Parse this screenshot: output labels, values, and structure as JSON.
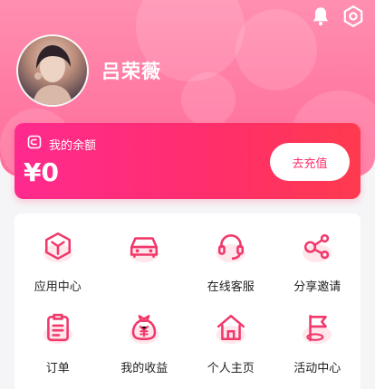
{
  "profile": {
    "name": "吕荣薇"
  },
  "top_icons": [
    "bell-icon",
    "settings-icon"
  ],
  "balance": {
    "title": "我的余额",
    "amount": "¥0",
    "recharge_label": "去充值"
  },
  "menu": {
    "items": [
      {
        "label": "应用中心",
        "icon": "cube-icon"
      },
      {
        "label": "",
        "icon": "car-icon"
      },
      {
        "label": "在线客服",
        "icon": "headset-icon"
      },
      {
        "label": "分享邀请",
        "icon": "share-icon"
      },
      {
        "label": "订单",
        "icon": "clipboard-icon"
      },
      {
        "label": "我的收益",
        "icon": "money-bag-icon"
      },
      {
        "label": "个人主页",
        "icon": "home-icon"
      },
      {
        "label": "活动中心",
        "icon": "flag-icon"
      }
    ]
  },
  "colors": {
    "accent": "#ff2f6a",
    "header": "#ff7aa3",
    "icon": "#f0386b"
  }
}
